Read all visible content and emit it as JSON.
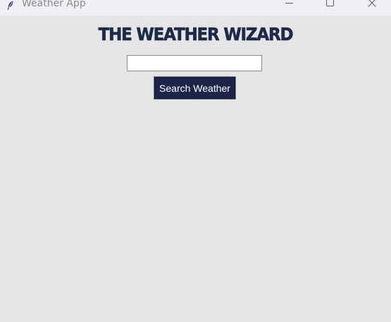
{
  "window": {
    "title": "Weather App",
    "app_icon": "feather-icon",
    "controls": {
      "minimize_icon": "minimize-icon",
      "maximize_icon": "maximize-icon",
      "close_icon": "close-icon"
    }
  },
  "main": {
    "heading": "THE WEATHER WIZARD",
    "search": {
      "value": "",
      "placeholder": ""
    },
    "search_button_label": "Search Weather"
  },
  "colors": {
    "background": "#e5e5e5",
    "titlebar": "#f0f0f4",
    "heading": "#1d2a4a",
    "button_bg": "#1d2548",
    "button_text": "#ffffff"
  }
}
